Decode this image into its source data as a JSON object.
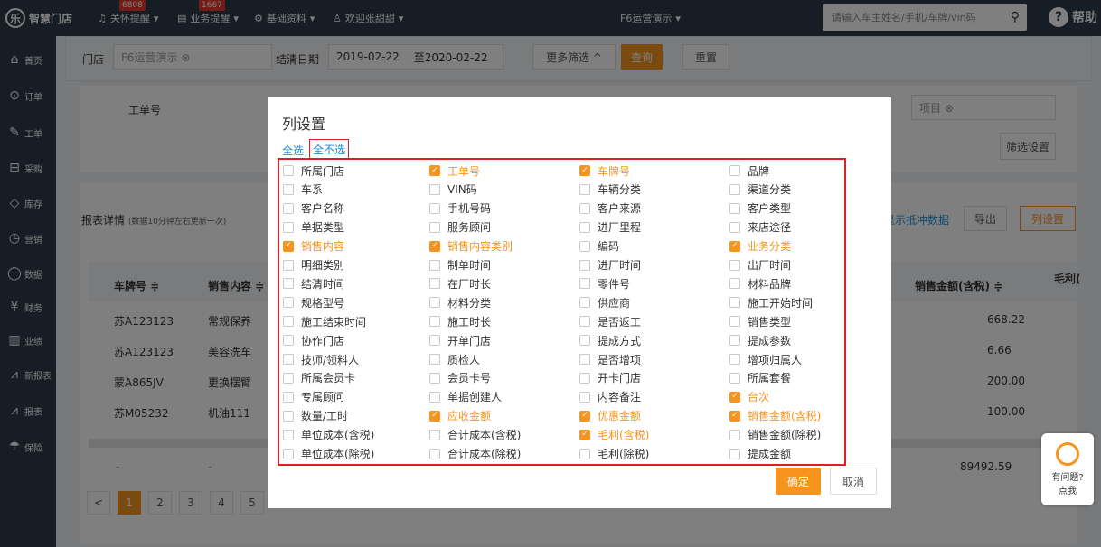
{
  "brand": {
    "name": "智慧门店",
    "logo_glyph": "乐"
  },
  "topnav": {
    "care": {
      "label": "关怀提醒",
      "badge": "6808"
    },
    "biz": {
      "label": "业务提醒",
      "badge": "1667"
    },
    "basic": {
      "label": "基础资料"
    },
    "user": {
      "label": "欢迎张甜甜"
    },
    "store": {
      "label": "F6运营演示"
    },
    "search_placeholder": "请输入车主姓名/手机/车牌/vin码",
    "help": "帮助"
  },
  "sidebar": [
    {
      "label": "首页",
      "icon": "⌂"
    },
    {
      "label": "订单",
      "icon": "⊙"
    },
    {
      "label": "工单",
      "icon": "✎"
    },
    {
      "label": "采购",
      "icon": "⊟"
    },
    {
      "label": "库存",
      "icon": "◇"
    },
    {
      "label": "营销",
      "icon": "◷"
    },
    {
      "label": "数据",
      "icon": "◯"
    },
    {
      "label": "财务",
      "icon": "¥"
    },
    {
      "label": "业绩",
      "icon": "▥"
    },
    {
      "label": "新报表",
      "icon": "⩘"
    },
    {
      "label": "报表",
      "icon": "⩘"
    },
    {
      "label": "保险",
      "icon": "☂"
    }
  ],
  "filter": {
    "store_label": "门店",
    "store_value": "F6运营演示 ⊗",
    "date_label": "结清日期",
    "date_from": "2019-02-22",
    "date_to": "至2020-02-22",
    "more": "更多筛选 ^",
    "query": "查询",
    "reset": "重置",
    "order_no_label": "工单号",
    "item_label": "项目 ⊗",
    "filter_settings": "筛选设置"
  },
  "report": {
    "title": "报表详情",
    "note": "(数据10分钟左右更新一次)",
    "show_link": "显示抵冲数据",
    "export": "导出",
    "columns": "列设置"
  },
  "table": {
    "headers": {
      "plate": "车牌号 ≑",
      "content": "销售内容 ≑",
      "amount": "销售金额(含税) ≑",
      "profit": "毛利("
    },
    "rows": [
      {
        "plate": "苏A123123",
        "content": "常规保养",
        "amount": "668.22"
      },
      {
        "plate": "苏A123123",
        "content": "美容洗车",
        "amount": "6.66"
      },
      {
        "plate": "蒙A865JV",
        "content": "更换摆臂",
        "amount": "200.00"
      },
      {
        "plate": "苏M05232",
        "content": "机油111",
        "amount": "100.00"
      }
    ],
    "total": {
      "plate": "-",
      "content": "-",
      "amount": "89492.59"
    }
  },
  "pager": [
    "<",
    "1",
    "2",
    "3",
    "4",
    "5"
  ],
  "modal": {
    "title": "列设置",
    "select_all": "全选",
    "select_none": "全不选",
    "ok": "确定",
    "cancel": "取消",
    "options": [
      [
        {
          "t": "所属门店",
          "c": false
        },
        {
          "t": "工单号",
          "c": true
        },
        {
          "t": "车牌号",
          "c": true
        },
        {
          "t": "品牌",
          "c": false
        }
      ],
      [
        {
          "t": "车系",
          "c": false
        },
        {
          "t": "VIN码",
          "c": false
        },
        {
          "t": "车辆分类",
          "c": false
        },
        {
          "t": "渠道分类",
          "c": false
        }
      ],
      [
        {
          "t": "客户名称",
          "c": false
        },
        {
          "t": "手机号码",
          "c": false
        },
        {
          "t": "客户来源",
          "c": false
        },
        {
          "t": "客户类型",
          "c": false
        }
      ],
      [
        {
          "t": "单据类型",
          "c": false
        },
        {
          "t": "服务顾问",
          "c": false
        },
        {
          "t": "进厂里程",
          "c": false
        },
        {
          "t": "来店途径",
          "c": false
        }
      ],
      [
        {
          "t": "销售内容",
          "c": true
        },
        {
          "t": "销售内容类别",
          "c": true
        },
        {
          "t": "编码",
          "c": false
        },
        {
          "t": "业务分类",
          "c": true
        }
      ],
      [
        {
          "t": "明细类别",
          "c": false
        },
        {
          "t": "制单时间",
          "c": false
        },
        {
          "t": "进厂时间",
          "c": false
        },
        {
          "t": "出厂时间",
          "c": false
        }
      ],
      [
        {
          "t": "结清时间",
          "c": false
        },
        {
          "t": "在厂时长",
          "c": false
        },
        {
          "t": "零件号",
          "c": false
        },
        {
          "t": "材料品牌",
          "c": false
        }
      ],
      [
        {
          "t": "规格型号",
          "c": false
        },
        {
          "t": "材料分类",
          "c": false
        },
        {
          "t": "供应商",
          "c": false
        },
        {
          "t": "施工开始时间",
          "c": false
        }
      ],
      [
        {
          "t": "施工结束时间",
          "c": false
        },
        {
          "t": "施工时长",
          "c": false
        },
        {
          "t": "是否返工",
          "c": false
        },
        {
          "t": "销售类型",
          "c": false
        }
      ],
      [
        {
          "t": "协作门店",
          "c": false
        },
        {
          "t": "开单门店",
          "c": false
        },
        {
          "t": "提成方式",
          "c": false
        },
        {
          "t": "提成参数",
          "c": false
        }
      ],
      [
        {
          "t": "技师/领料人",
          "c": false
        },
        {
          "t": "质检人",
          "c": false
        },
        {
          "t": "是否增项",
          "c": false
        },
        {
          "t": "增项归属人",
          "c": false
        }
      ],
      [
        {
          "t": "所属会员卡",
          "c": false
        },
        {
          "t": "会员卡号",
          "c": false
        },
        {
          "t": "开卡门店",
          "c": false
        },
        {
          "t": "所属套餐",
          "c": false
        }
      ],
      [
        {
          "t": "专属顾问",
          "c": false
        },
        {
          "t": "单据创建人",
          "c": false
        },
        {
          "t": "内容备注",
          "c": false
        },
        {
          "t": "台次",
          "c": true
        }
      ],
      [
        {
          "t": "数量/工时",
          "c": false
        },
        {
          "t": "应收金额",
          "c": true
        },
        {
          "t": "优惠金额",
          "c": true
        },
        {
          "t": "销售金额(含税)",
          "c": true
        }
      ],
      [
        {
          "t": "单位成本(含税)",
          "c": false
        },
        {
          "t": "合计成本(含税)",
          "c": false
        },
        {
          "t": "毛利(含税)",
          "c": true
        },
        {
          "t": "销售金额(除税)",
          "c": false
        }
      ],
      [
        {
          "t": "单位成本(除税)",
          "c": false
        },
        {
          "t": "合计成本(除税)",
          "c": false
        },
        {
          "t": "毛利(除税)",
          "c": false
        },
        {
          "t": "提成金额",
          "c": false
        }
      ]
    ]
  },
  "chat": {
    "line1": "有问题?",
    "line2": "点我"
  }
}
